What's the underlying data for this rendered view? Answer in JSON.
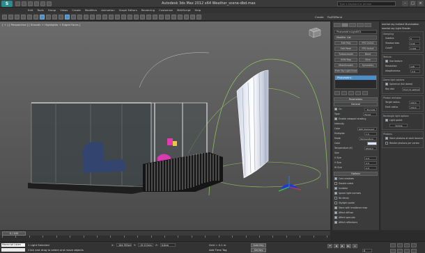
{
  "app": {
    "logo_text": "S",
    "title": "Autodesk 3ds Max 2012 x64     Weather_scene-dbd.max",
    "search_placeholder": "Type a keyword or phrase",
    "window_controls": [
      "–",
      "□",
      "×"
    ]
  },
  "menu": [
    "Edit",
    "Tools",
    "Group",
    "Views",
    "Create",
    "Modifiers",
    "Animation",
    "Graph Editors",
    "Rendering",
    "Customize",
    "MAXScript",
    "Help"
  ],
  "toolbar": {
    "right_buttons": [
      "Create",
      "Fix/EDRend"
    ]
  },
  "viewport": {
    "label": "[ + ] [ Perspective ] [ Smooth + Highlights + Edged Faces ]"
  },
  "command_panel": {
    "object_name": "PhotometricLight001",
    "modifier_list": "Modifier List",
    "modifier_buttons": [
      "Edit Poly",
      "FFD 2x2x2",
      "Edit Mesh",
      "FFD 4x4x4",
      "Turbosmooth",
      "Bend",
      "UVW Map",
      "Slice",
      "MeshSmooth",
      "Symmetry",
      "Free Sky Light Illum"
    ],
    "stack_items": [
      "Photometric"
    ],
    "selected_stack": "Photometric",
    "rollout_general": "General",
    "rollout_shadows_header": "Parameters",
    "params": {
      "on": "On",
      "exclude": "Exclude",
      "type_label": "Type:",
      "type_value": "Target",
      "targeted": "Enable viewport shading",
      "intensity_label": "Intensity",
      "color_label": "Color",
      "color_preset": "D65 Illuminant",
      "kelvin": "Kelvin",
      "kelvin_value": "6500.0",
      "filter_label": "Filter Color",
      "multiplier": "Multiplier",
      "multiplier_value": "1.0",
      "mode_label": "Mode",
      "mode_value": "Temperature",
      "color2": "Color",
      "temperature": "Temperature (K)",
      "temperature_value": "6500.0",
      "size_label": "Size",
      "length": "U Size",
      "length_value": "2.0",
      "width": "V Size",
      "width_value": "2.0",
      "w_size": "W Size",
      "w_size_value": "2.0"
    },
    "options_header": "Options",
    "options": [
      "Cast shadows",
      "Double sided",
      "Invisible",
      "Ignore light normals",
      "No decay",
      "Skylight portal",
      "Store with irradiance map",
      "Affect diffuse",
      "Affect specular",
      "Affect reflections"
    ]
  },
  "side_panel": {
    "title": "mental ray Indirect Illumination",
    "subtitle": "mental ray Light Shader",
    "sampling": "Sampling",
    "subdivs_label": "Subdivs",
    "subdivs_value": "8",
    "shadow_bias_label": "Shadow bias",
    "shadow_bias_value": "0.02",
    "cutoff_label": "Cutoff",
    "cutoff_value": "0.001",
    "texture_label": "Texture",
    "use_texture": "Use texture",
    "resolution_label": "Resolution",
    "resolution_value": "128",
    "adaptiveness_label": "Adaptiveness",
    "adaptiveness_value": "2.0",
    "dome_options": "Dome light options",
    "dome_spherical": "Spherical (full dome)",
    "ray_dist_label": "Ray dist",
    "ray_dist_value": "From IS settings",
    "photon_emission": "Photon emission",
    "target_radius_label": "Target radius",
    "target_radius_value": "100.0",
    "emit_radius_label": "Emit radius",
    "emit_radius_value": "150.0",
    "rect_options": "Rectangle light options",
    "light_portal": "Light portal",
    "simple": "Simple",
    "photons_label": "Photons",
    "store_photons": "Store photons at each bounce",
    "render_photons": "Render photons per vertex"
  },
  "timeline": {
    "slider_label": "0 / 100",
    "ticks": 24
  },
  "status": {
    "maxscript": "Maxscript Listen",
    "status_message": "1 Light Selected",
    "prompt_message": "Click and drag to select and move objects",
    "x_label": "X:",
    "x_value": "-104.783cm",
    "y_label": "Y:",
    "y_value": "-15.112cm",
    "z_label": "Z:",
    "z_value": "0.0cm",
    "grid": "Grid = 0.1 m",
    "add_time_tag": "Add Time Tag",
    "autokey": "Auto Key",
    "setkey": "Set Key",
    "playback": [
      "⏮",
      "◀",
      "▶",
      "▶|",
      "⏭"
    ],
    "frame": "0"
  }
}
